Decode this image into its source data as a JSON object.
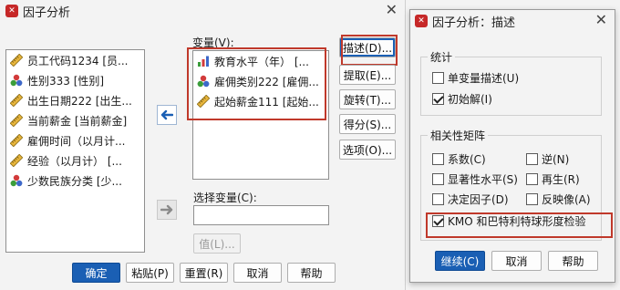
{
  "main_dialog": {
    "title": "因子分析",
    "close_glyph": "✕",
    "source_list": [
      {
        "label": "员工代码1234 [员...",
        "icon": "ruler-scale-icon"
      },
      {
        "label": "性别333 [性别]",
        "icon": "nominal-balls-icon"
      },
      {
        "label": "出生日期222 [出生...",
        "icon": "ruler-scale-icon"
      },
      {
        "label": "当前薪金 [当前薪金]",
        "icon": "ruler-scale-icon"
      },
      {
        "label": "雇佣时间（以月计...",
        "icon": "ruler-scale-icon"
      },
      {
        "label": "经验（以月计） [...",
        "icon": "ruler-scale-icon"
      },
      {
        "label": "少数民族分类 [少...",
        "icon": "nominal-balls-icon"
      }
    ],
    "variables_label": "变量(V):",
    "variables_list": [
      {
        "label": "教育水平（年） [...",
        "icon": "bar-ordinal-icon"
      },
      {
        "label": "雇佣类别222 [雇佣...",
        "icon": "nominal-balls-icon"
      },
      {
        "label": "起始薪金111 [起始...",
        "icon": "ruler-scale-icon"
      }
    ],
    "selection_label": "选择变量(C):",
    "selection_value": "",
    "value_button": "值(L)...",
    "side_buttons": [
      "描述(D)...",
      "提取(E)...",
      "旋转(T)...",
      "得分(S)...",
      "选项(O)..."
    ],
    "bottom_buttons": [
      "确定",
      "粘贴(P)",
      "重置(R)",
      "取消",
      "帮助"
    ]
  },
  "desc_dialog": {
    "title": "因子分析：描述",
    "close_glyph": "✕",
    "stats_group": "统计",
    "stats_items": [
      {
        "label": "单变量描述(U)",
        "checked": false
      },
      {
        "label": "初始解(I)",
        "checked": true
      }
    ],
    "corr_group": "相关性矩阵",
    "corr_items": [
      {
        "label": "系数(C)",
        "checked": false
      },
      {
        "label": "逆(N)",
        "checked": false
      },
      {
        "label": "显著性水平(S)",
        "checked": false
      },
      {
        "label": "再生(R)",
        "checked": false
      },
      {
        "label": "决定因子(D)",
        "checked": false
      },
      {
        "label": "反映像(A)",
        "checked": false
      },
      {
        "label": "KMO 和巴特利特球形度检验",
        "checked": true
      }
    ],
    "buttons": [
      "继续(C)",
      "取消",
      "帮助"
    ]
  },
  "colors": {
    "accent": "#1a5fb4",
    "highlight": "#c0392b",
    "app_icon": "#c62828"
  }
}
